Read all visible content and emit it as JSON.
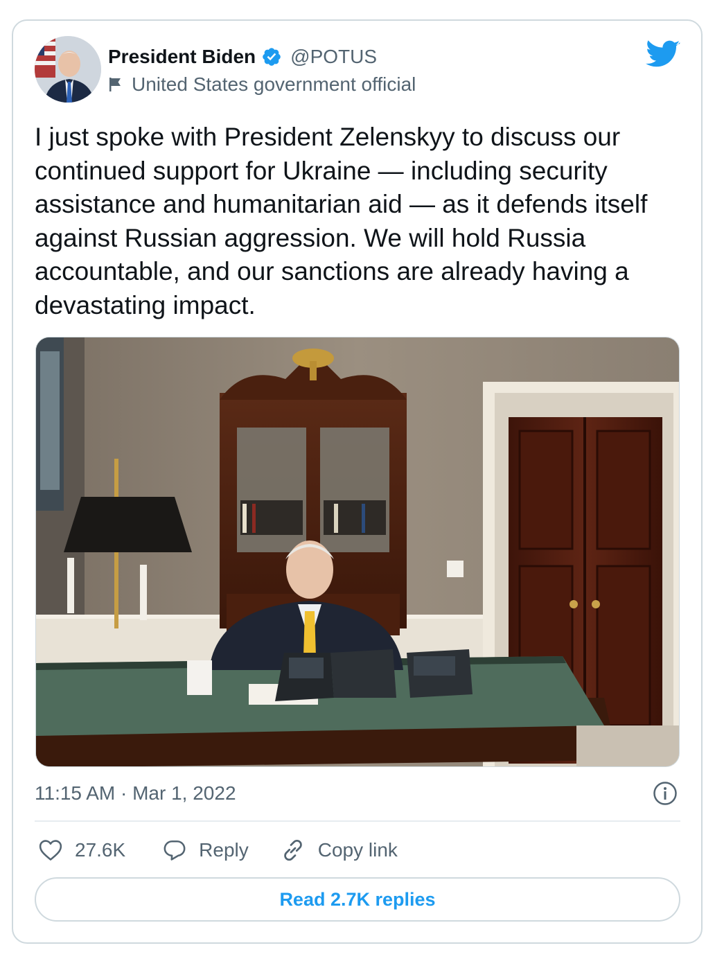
{
  "author": {
    "display_name": "President Biden",
    "handle": "@POTUS",
    "label": "United States government official",
    "verified": true,
    "avatar_icon": "person-portrait-avatar"
  },
  "tweet": {
    "text": "I just spoke with President Zelenskyy to discuss our\ncontinued support for Ukraine — including security\nassistance and humanitarian aid — as it defends itself\nagainst Russian aggression. We will hold Russia\naccountable, and our sanctions are already having a\ndevastating impact.",
    "timestamp": "11:15 AM · Mar 1, 2022"
  },
  "actions": {
    "likes": "27.6K",
    "reply_label": "Reply",
    "copy_link_label": "Copy link",
    "read_replies_label": "Read 2.7K replies"
  },
  "icons": {
    "brand": "twitter-bird-icon",
    "verified": "verified-badge-icon",
    "label": "flag-icon",
    "info": "info-icon",
    "like": "heart-icon",
    "reply": "speech-bubble-icon",
    "link": "link-icon"
  },
  "colors": {
    "brand": "#1d9bf0",
    "text": "#0f1419",
    "muted": "#536471",
    "border": "#cfd9de"
  }
}
